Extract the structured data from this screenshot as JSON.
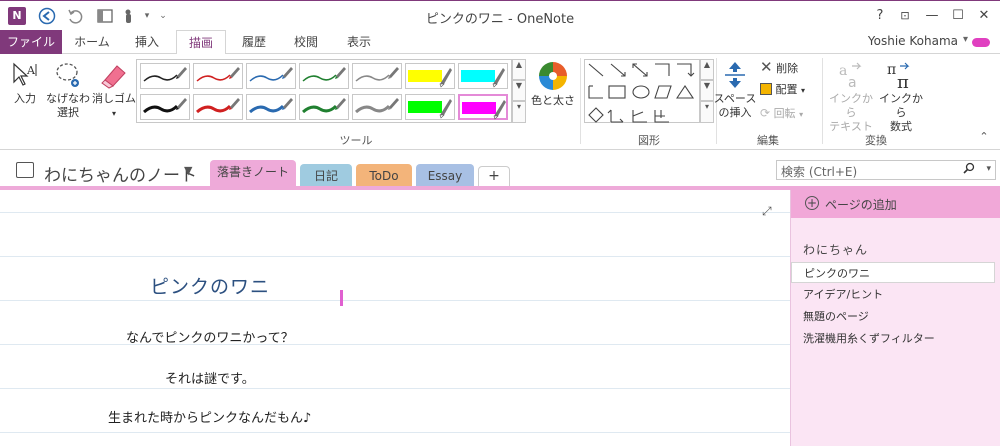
{
  "window": {
    "title": "ピンクのワニ - OneNote",
    "app_icon": "N",
    "help": "?",
    "minimize": "—",
    "maximize": "☐",
    "close": "✕",
    "ribbon_display": "⊡"
  },
  "ribbon_tabs": {
    "file": "ファイル",
    "home": "ホーム",
    "insert": "挿入",
    "draw": "描画",
    "history": "履歴",
    "review": "校閲",
    "view": "表示"
  },
  "user": {
    "name": "Yoshie Kohama"
  },
  "ribbon": {
    "tools": {
      "type": "入力",
      "lasso_line1": "なげなわ",
      "lasso_line2": "選択",
      "eraser": "消しゴム",
      "label": "ツール"
    },
    "color_thickness": "色と太さ",
    "shapes_label": "図形",
    "edit": {
      "space_line1": "スペース",
      "space_line2": "の挿入",
      "delete": "削除",
      "arrange": "配置",
      "rotate": "回転",
      "label": "編集"
    },
    "convert": {
      "ink_text_line1": "インクから",
      "ink_text_line2": "テキスト",
      "ink_math_line1": "インクから",
      "ink_math_line2": "数式",
      "label": "変換"
    },
    "pens": [
      {
        "color": "#222222",
        "width": 1.5,
        "hl": false
      },
      {
        "color": "#d02020",
        "width": 1.5,
        "hl": false
      },
      {
        "color": "#2a6ab0",
        "width": 1.5,
        "hl": false
      },
      {
        "color": "#208030",
        "width": 1.5,
        "hl": false
      },
      {
        "color": "#888888",
        "width": 1.5,
        "hl": false
      },
      {
        "color": "#ffff00",
        "width": 12,
        "hl": true
      },
      {
        "color": "#00ffff",
        "width": 12,
        "hl": true
      },
      {
        "color": "#111111",
        "width": 3,
        "hl": false
      },
      {
        "color": "#d02020",
        "width": 3,
        "hl": false
      },
      {
        "color": "#2a6ab0",
        "width": 3,
        "hl": false
      },
      {
        "color": "#208030",
        "width": 3,
        "hl": false
      },
      {
        "color": "#888888",
        "width": 3,
        "hl": false
      },
      {
        "color": "#00ff00",
        "width": 12,
        "hl": true
      },
      {
        "color": "#ff00ff",
        "width": 12,
        "hl": true
      }
    ]
  },
  "notebook": {
    "name": "わにちゃんのノート",
    "sections": [
      {
        "label": "落書きノート",
        "color": "#eeaad9"
      },
      {
        "label": "日記",
        "color": "#9fcbe0"
      },
      {
        "label": "ToDo",
        "color": "#f3b47a"
      },
      {
        "label": "Essay",
        "color": "#a8c0e4"
      },
      {
        "label": "+",
        "color": "#ffffff"
      }
    ]
  },
  "search": {
    "placeholder": "検索 (Ctrl+E)"
  },
  "page": {
    "title": "ピンクのワニ",
    "lines": [
      "なんでピンクのワニかって？",
      "それは謎です。",
      "生まれた時からピンクなんだもん♪"
    ]
  },
  "page_pane": {
    "add_page": "ページの追加",
    "section_header": "わにちゃん",
    "pages": [
      {
        "label": "ピンクのワニ",
        "active": true
      },
      {
        "label": "アイデア/ヒント",
        "active": false
      },
      {
        "label": "無題のページ",
        "active": false
      },
      {
        "label": "洗濯機用糸くずフィルター",
        "active": false
      }
    ]
  }
}
